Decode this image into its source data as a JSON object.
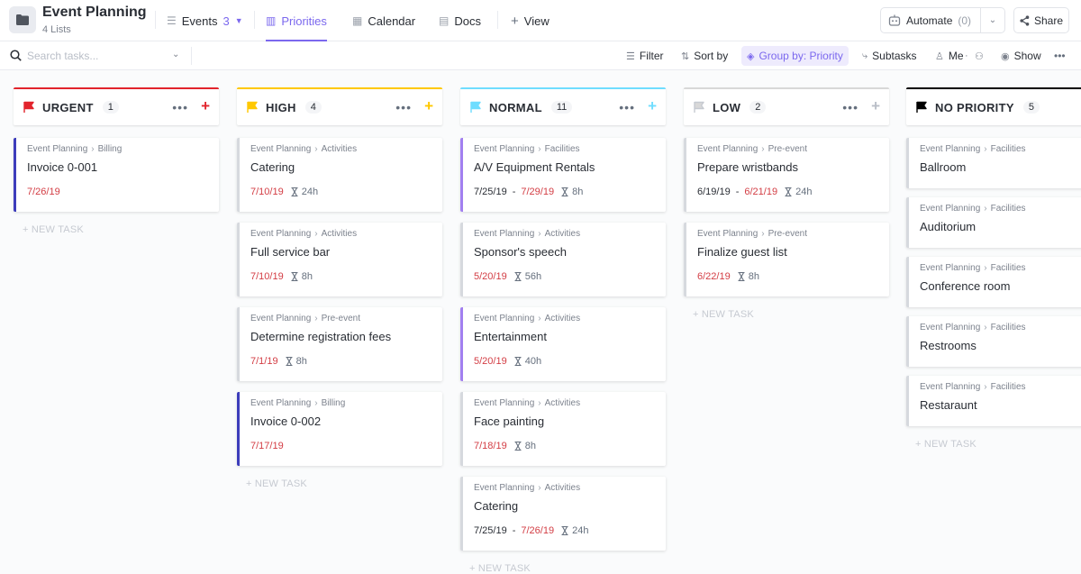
{
  "header": {
    "title": "Event Planning",
    "subtitle": "4 Lists",
    "tabs": [
      {
        "label": "Events",
        "count": "3",
        "icon": "list-icon"
      },
      {
        "label": "Priorities",
        "icon": "board-icon"
      },
      {
        "label": "Calendar",
        "icon": "calendar-icon"
      },
      {
        "label": "Docs",
        "icon": "doc-icon"
      },
      {
        "label": "View",
        "icon": "plus-icon"
      }
    ],
    "automate_label": "Automate",
    "automate_count": "(0)",
    "share_label": "Share",
    "more": "•••"
  },
  "toolbar": {
    "search_placeholder": "Search tasks...",
    "filter": "Filter",
    "sort": "Sort by",
    "group": "Group by: Priority",
    "subtasks": "Subtasks",
    "me": "Me",
    "show": "Show",
    "more": "•••"
  },
  "colors": {
    "accent": "#7b68ee",
    "urgent": "#e2242c",
    "high": "#ffc800",
    "normal": "#6fddff",
    "low": "#d8d8d8",
    "none": "#000000",
    "overdue": "#d33d44"
  },
  "new_task_label": "+ NEW TASK",
  "columns": [
    {
      "title": "URGENT",
      "count": "1",
      "color": "#e2242c",
      "cards": [
        {
          "list": "Event Planning",
          "folder": "Billing",
          "title": "Invoice 0-001",
          "due": "7/26/19",
          "bar": "#3d3dbb"
        }
      ]
    },
    {
      "title": "HIGH",
      "count": "4",
      "color": "#ffc800",
      "cards": [
        {
          "list": "Event Planning",
          "folder": "Activities",
          "title": "Catering",
          "due": "7/10/19",
          "estimate": "24h"
        },
        {
          "list": "Event Planning",
          "folder": "Activities",
          "title": "Full service bar",
          "due": "7/10/19",
          "estimate": "8h"
        },
        {
          "list": "Event Planning",
          "folder": "Pre-event",
          "title": "Determine registration fees",
          "due": "7/1/19",
          "estimate": "8h"
        },
        {
          "list": "Event Planning",
          "folder": "Billing",
          "title": "Invoice 0-002",
          "due": "7/17/19",
          "bar": "#3d3dbb"
        }
      ]
    },
    {
      "title": "NORMAL",
      "count": "11",
      "color": "#6fddff",
      "cards": [
        {
          "list": "Event Planning",
          "folder": "Facilities",
          "title": "A/V Equipment Rentals",
          "start": "7/25/19",
          "due": "7/29/19",
          "estimate": "8h",
          "bar": "#a27ff0"
        },
        {
          "list": "Event Planning",
          "folder": "Activities",
          "title": "Sponsor's speech",
          "due": "5/20/19",
          "estimate": "56h"
        },
        {
          "list": "Event Planning",
          "folder": "Activities",
          "title": "Entertainment",
          "due": "5/20/19",
          "estimate": "40h",
          "bar": "#a27ff0"
        },
        {
          "list": "Event Planning",
          "folder": "Activities",
          "title": "Face painting",
          "due": "7/18/19",
          "estimate": "8h"
        },
        {
          "list": "Event Planning",
          "folder": "Activities",
          "title": "Catering",
          "start": "7/25/19",
          "due": "7/26/19",
          "estimate": "24h"
        }
      ]
    },
    {
      "title": "LOW",
      "count": "2",
      "color": "#d8d8d8",
      "cards": [
        {
          "list": "Event Planning",
          "folder": "Pre-event",
          "title": "Prepare wristbands",
          "start": "6/19/19",
          "due": "6/21/19",
          "estimate": "24h"
        },
        {
          "list": "Event Planning",
          "folder": "Pre-event",
          "title": "Finalize guest list",
          "due": "6/22/19",
          "estimate": "8h"
        }
      ]
    },
    {
      "title": "NO PRIORITY",
      "count": "5",
      "color": "#000000",
      "cards": [
        {
          "list": "Event Planning",
          "folder": "Facilities",
          "title": "Ballroom"
        },
        {
          "list": "Event Planning",
          "folder": "Facilities",
          "title": "Auditorium"
        },
        {
          "list": "Event Planning",
          "folder": "Facilities",
          "title": "Conference room"
        },
        {
          "list": "Event Planning",
          "folder": "Facilities",
          "title": "Restrooms"
        },
        {
          "list": "Event Planning",
          "folder": "Facilities",
          "title": "Restaraunt"
        }
      ]
    }
  ]
}
